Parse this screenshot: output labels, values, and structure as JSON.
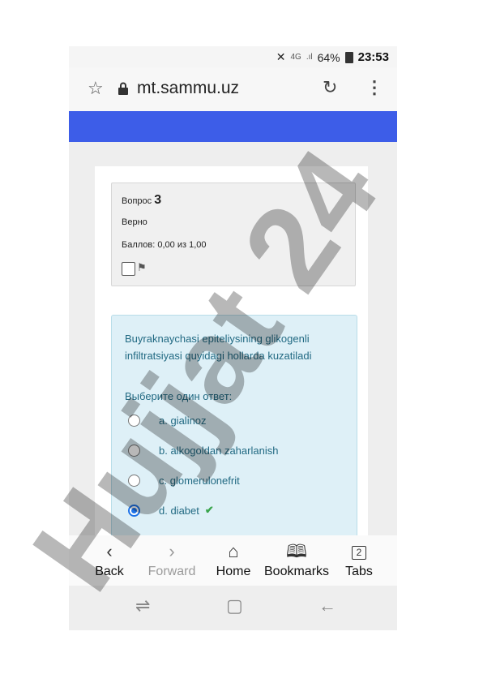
{
  "status_bar": {
    "network": "4G",
    "signal": ".ıl",
    "battery": "64%",
    "time": "23:53"
  },
  "browser": {
    "url": "mt.sammu.uz"
  },
  "question_info": {
    "label": "Вопрос",
    "number": "3",
    "state": "Верно",
    "grade": "Баллов: 0,00 из 1,00"
  },
  "question": {
    "text": "Buyraknaychasi epiteliysining glikogenli infiltratsiyasi quyidagi hollarda kuzatiladi",
    "prompt": "Выберите один ответ:",
    "options": [
      {
        "label": "a. gialinoz",
        "selected": false
      },
      {
        "label": "b. alkogoldan zaharlanish",
        "selected": false
      },
      {
        "label": "c. glomerulonefrit",
        "selected": false
      },
      {
        "label": "d. diabet",
        "selected": true,
        "correct_mark": "✔"
      }
    ]
  },
  "bottom_nav": {
    "back": "Back",
    "forward": "Forward",
    "home": "Home",
    "bookmarks": "Bookmarks",
    "tabs": "Tabs",
    "tabs_count": "2"
  },
  "watermark": {
    "text": "Hujjat 24",
    "color": "#7b7bff"
  },
  "colors": {
    "header_bar": "#3d5de8",
    "question_bg": "#def0f7",
    "question_text": "#226a83",
    "correct": "#3aa54c"
  }
}
